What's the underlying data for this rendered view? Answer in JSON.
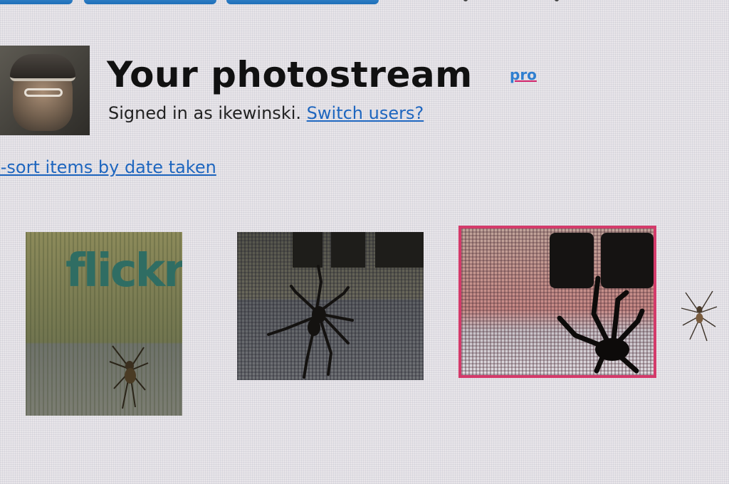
{
  "header": {
    "title": "Your photostream",
    "pro_badge": "pro",
    "signed_in_text": "Signed in as ikewinski.",
    "switch_users_link": "Switch users?"
  },
  "resort_link": "e-sort items by date taken",
  "photos": [
    {
      "watermark_text": "flickr",
      "watermark_dot": "r"
    },
    {},
    {
      "selected": true
    }
  ],
  "colors": {
    "link": "#1e66bf",
    "pro": "#2f7fd0",
    "selected_border": "#d43a6a",
    "tab": "#2f80cf"
  }
}
